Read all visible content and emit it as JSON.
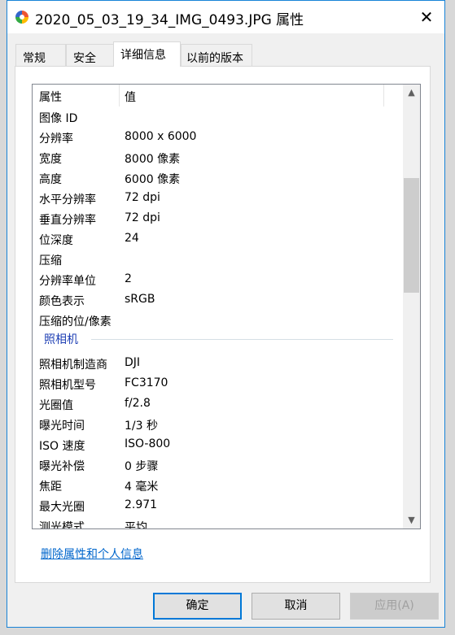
{
  "window": {
    "title": "2020_05_03_19_34_IMG_0493.JPG 属性",
    "close_glyph": "✕"
  },
  "tabs": [
    {
      "label": "常规"
    },
    {
      "label": "安全"
    },
    {
      "label": "详细信息"
    },
    {
      "label": "以前的版本"
    }
  ],
  "active_tab": "详细信息",
  "list": {
    "headers": {
      "property": "属性",
      "value": "值"
    },
    "rows": [
      {
        "k": "图像 ID",
        "v": ""
      },
      {
        "k": "分辨率",
        "v": "8000 x 6000"
      },
      {
        "k": "宽度",
        "v": "8000 像素"
      },
      {
        "k": "高度",
        "v": "6000 像素"
      },
      {
        "k": "水平分辨率",
        "v": "72 dpi"
      },
      {
        "k": "垂直分辨率",
        "v": "72 dpi"
      },
      {
        "k": "位深度",
        "v": "24"
      },
      {
        "k": "压缩",
        "v": ""
      },
      {
        "k": "分辨率单位",
        "v": "2"
      },
      {
        "k": "颜色表示",
        "v": "sRGB"
      },
      {
        "k": "压缩的位/像素",
        "v": ""
      }
    ],
    "group": "照相机",
    "rows2": [
      {
        "k": "照相机制造商",
        "v": "DJI"
      },
      {
        "k": "照相机型号",
        "v": "FC3170"
      },
      {
        "k": "光圈值",
        "v": "f/2.8"
      },
      {
        "k": "曝光时间",
        "v": "1/3 秒"
      },
      {
        "k": "ISO 速度",
        "v": "ISO-800"
      },
      {
        "k": "曝光补偿",
        "v": "0 步骤"
      },
      {
        "k": "焦距",
        "v": "4 毫米"
      },
      {
        "k": "最大光圈",
        "v": "2.971"
      },
      {
        "k": "测光模式",
        "v": "平均"
      }
    ]
  },
  "link": "删除属性和个人信息",
  "buttons": {
    "ok": "确定",
    "cancel": "取消",
    "apply": "应用(A)"
  }
}
